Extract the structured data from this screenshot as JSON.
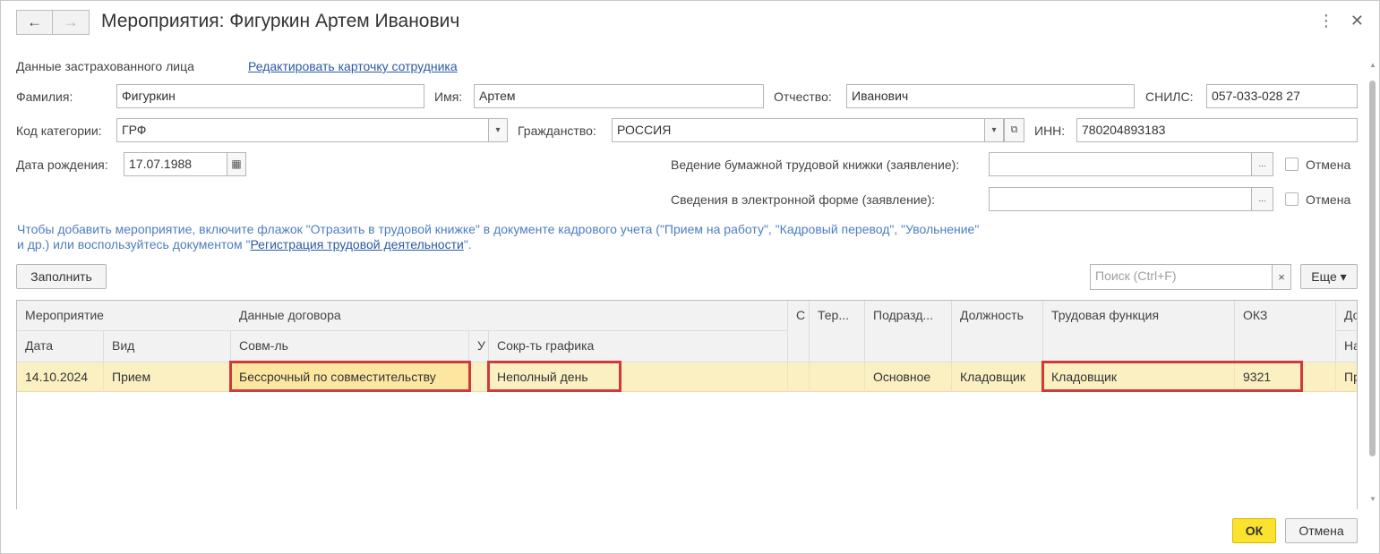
{
  "window": {
    "title": "Мероприятия: Фигуркин Артем Иванович",
    "back_icon": "←",
    "forward_icon": "→",
    "more_icon": "⋮",
    "close_icon": "✕"
  },
  "insured": {
    "section_label": "Данные застрахованного лица",
    "edit_link": "Редактировать карточку сотрудника"
  },
  "fields": {
    "lastname_label": "Фамилия:",
    "lastname": "Фигуркин",
    "firstname_label": "Имя:",
    "firstname": "Артем",
    "patronymic_label": "Отчество:",
    "patronymic": "Иванович",
    "snils_label": "СНИЛС:",
    "snils": "057-033-028 27",
    "category_label": "Код категории:",
    "category": "ГРФ",
    "citizenship_label": "Гражданство:",
    "citizenship": "РОССИЯ",
    "inn_label": "ИНН:",
    "inn": "780204893183",
    "birthdate_label": "Дата рождения:",
    "birthdate": "17.07.1988",
    "paper_book_label": "Ведение бумажной трудовой книжки (заявление):",
    "paper_book": "",
    "electronic_label": "Сведения в электронной форме (заявление):",
    "electronic": "",
    "cancel_label_1": "Отмена",
    "cancel_label_2": "Отмена",
    "select_arrow": "▾",
    "ellipsis": "...",
    "calendar_icon": "▦",
    "open_icon": "⧉"
  },
  "info": {
    "text_before": "Чтобы добавить мероприятие, включите флажок \"Отразить в трудовой книжке\" в документе кадрового учета (\"Прием на работу\", \"Кадровый перевод\", \"Увольнение\" и др.) или воспользуйтесь документом \"",
    "link": "Регистрация трудовой деятельности",
    "text_after": "\"."
  },
  "toolbar": {
    "fill_button": "Заполнить",
    "search_placeholder": "Поиск (Ctrl+F)",
    "search_clear": "×",
    "more_button": "Еще ▾"
  },
  "table": {
    "header_top": {
      "event": "Мероприятие",
      "contract": "Данные договора",
      "c": "С",
      "ter": "Тер...",
      "dept": "Подразд...",
      "position": "Должность",
      "labor_function": "Трудовая функция",
      "okz": "ОКЗ",
      "do": "До"
    },
    "header_sub": {
      "date": "Дата",
      "kind": "Вид",
      "combo": "Совм-ль",
      "u": "У",
      "shortened": "Сокр-ть графика",
      "na": "На"
    },
    "rows": [
      {
        "date": "14.10.2024",
        "kind": "Прием",
        "combo": "Бессрочный по совместительству",
        "shortened": "Неполный день",
        "dept": "Основное",
        "position": "Кладовщик",
        "labor_function": "Кладовщик",
        "okz": "9321",
        "tail": "Пр"
      }
    ]
  },
  "footer": {
    "ok": "ОК",
    "cancel": "Отмена"
  },
  "colors": {
    "highlight": "#d23a3a",
    "selected_row": "#fbf0c2",
    "ok_button": "#fbe22e",
    "info_text": "#4d7ec0"
  }
}
